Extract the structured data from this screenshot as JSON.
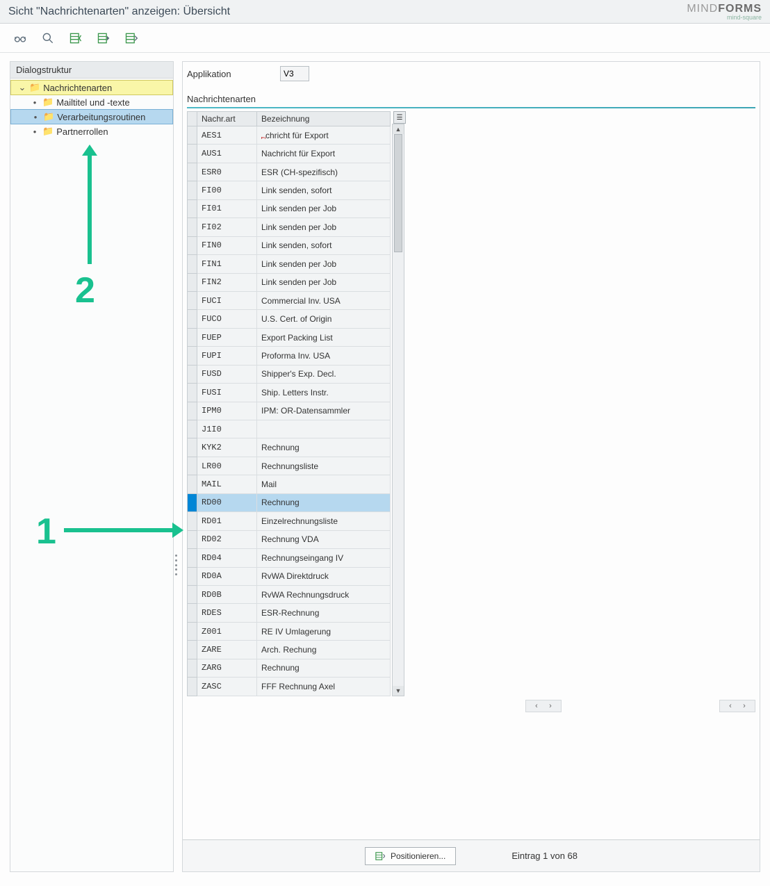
{
  "title": "Sicht \"Nachrichtenarten\" anzeigen: Übersicht",
  "brand_light": "MIND",
  "brand_bold": "FORMS",
  "brand_sub": "mind-square",
  "sidebar": {
    "header": "Dialogstruktur",
    "root": "Nachrichtenarten",
    "children": [
      "Mailtitel und -texte",
      "Verarbeitungsroutinen",
      "Partnerrollen"
    ],
    "selected_index": 1
  },
  "app": {
    "label": "Applikation",
    "value": "V3"
  },
  "section_title": "Nachrichtenarten",
  "columns": {
    "code": "Nachr.art",
    "desc": "Bezeichnung"
  },
  "selected_row_index": 19,
  "cursor_row_index": 0,
  "rows": [
    {
      "code": "AES1",
      "desc": "chricht für Export",
      "cursor": true
    },
    {
      "code": "AUS1",
      "desc": "Nachricht für Export"
    },
    {
      "code": "ESR0",
      "desc": "ESR (CH-spezifisch)"
    },
    {
      "code": "FI00",
      "desc": "Link senden, sofort"
    },
    {
      "code": "FI01",
      "desc": "Link senden per Job"
    },
    {
      "code": "FI02",
      "desc": "Link senden per Job"
    },
    {
      "code": "FIN0",
      "desc": "Link senden, sofort"
    },
    {
      "code": "FIN1",
      "desc": "Link senden per Job"
    },
    {
      "code": "FIN2",
      "desc": "Link senden per Job"
    },
    {
      "code": "FUCI",
      "desc": "Commercial Inv. USA"
    },
    {
      "code": "FUCO",
      "desc": "U.S. Cert. of Origin"
    },
    {
      "code": "FUEP",
      "desc": "Export Packing List"
    },
    {
      "code": "FUPI",
      "desc": "Proforma Inv. USA"
    },
    {
      "code": "FUSD",
      "desc": "Shipper's Exp. Decl."
    },
    {
      "code": "FUSI",
      "desc": "Ship. Letters Instr."
    },
    {
      "code": "IPM0",
      "desc": "IPM: OR-Datensammler"
    },
    {
      "code": "J1I0",
      "desc": ""
    },
    {
      "code": "KYK2",
      "desc": "Rechnung"
    },
    {
      "code": "LR00",
      "desc": "Rechnungsliste"
    },
    {
      "code": "MAIL",
      "desc": "Mail"
    },
    {
      "code": "RD00",
      "desc": "Rechnung"
    },
    {
      "code": "RD01",
      "desc": "Einzelrechnungsliste"
    },
    {
      "code": "RD02",
      "desc": "Rechnung VDA"
    },
    {
      "code": "RD04",
      "desc": "Rechnungseingang IV"
    },
    {
      "code": "RD0A",
      "desc": "RvWA Direktdruck"
    },
    {
      "code": "RD0B",
      "desc": "RvWA Rechnungsdruck"
    },
    {
      "code": "RDES",
      "desc": "ESR-Rechnung"
    },
    {
      "code": "Z001",
      "desc": "RE IV Umlagerung"
    },
    {
      "code": "ZARE",
      "desc": "Arch. Rechung"
    },
    {
      "code": "ZARG",
      "desc": "Rechnung"
    },
    {
      "code": "ZASC",
      "desc": "FFF Rechnung Axel"
    }
  ],
  "footer": {
    "position_btn": "Positionieren...",
    "entry_text": "Eintrag 1 von 68"
  },
  "annotations": {
    "one": "1",
    "two": "2"
  }
}
